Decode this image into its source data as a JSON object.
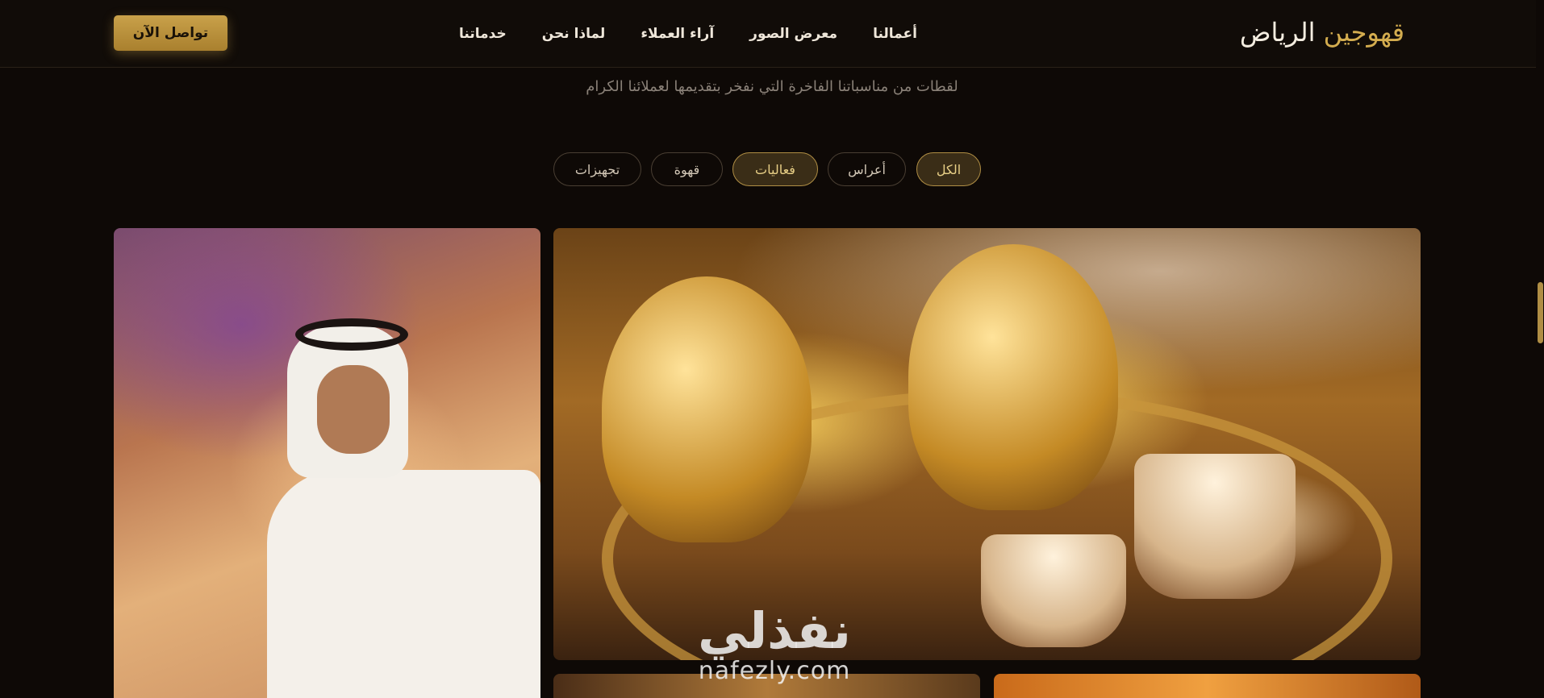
{
  "header": {
    "logo": {
      "accent": "قهوجين",
      "main": "الرياض"
    },
    "nav": [
      {
        "label": "خدماتنا"
      },
      {
        "label": "لماذا نحن"
      },
      {
        "label": "آراء العملاء"
      },
      {
        "label": "معرض الصور"
      },
      {
        "label": "أعمالنا"
      }
    ],
    "cta_label": "تواصل الآن"
  },
  "gallery": {
    "subtitle": "لقطات من مناسباتنا الفاخرة التي نفخر بتقديمها لعملائنا الكرام",
    "filters": [
      {
        "label": "الكل",
        "active": true
      },
      {
        "label": "أعراس",
        "active": false
      },
      {
        "label": "فعاليات",
        "active": true
      },
      {
        "label": "قهوة",
        "active": false
      },
      {
        "label": "تجهيزات",
        "active": false
      }
    ]
  },
  "watermark": {
    "arabic": "نفذلي",
    "latin": "nafezly.com"
  },
  "colors": {
    "background": "#0e0906",
    "gold": "#c9a14a",
    "accent_text": "#d4ad4f"
  }
}
